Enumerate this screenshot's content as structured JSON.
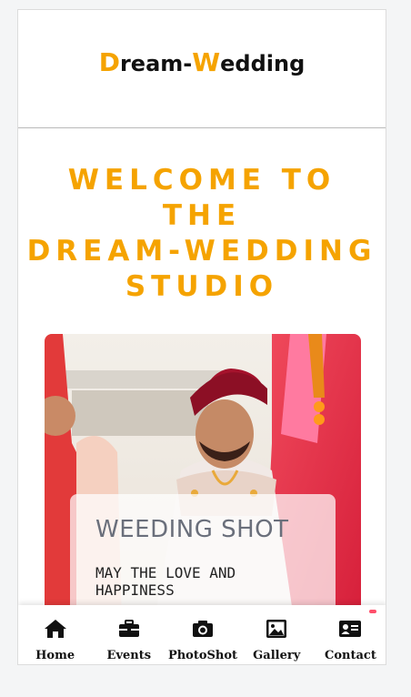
{
  "brand": {
    "first_initial": "D",
    "first_rest": "ream-",
    "second_initial": "W",
    "second_rest": "edding"
  },
  "welcome": {
    "line1": "WELCOME TO THE",
    "line2": "DREAM-WEDDING",
    "line3": "STUDIO"
  },
  "hero_card": {
    "title": "WEEDING SHOT",
    "subtitle": "MAY THE LOVE AND HAPPINESS"
  },
  "nav": {
    "items": [
      {
        "label": "Home",
        "icon": "home-icon"
      },
      {
        "label": "Events",
        "icon": "briefcase-icon"
      },
      {
        "label": "PhotoShot",
        "icon": "camera-icon"
      },
      {
        "label": "Gallery",
        "icon": "image-icon"
      },
      {
        "label": "Contact",
        "icon": "contact-card-icon"
      }
    ]
  },
  "colors": {
    "accent": "#f5a300",
    "text": "#111111",
    "card_title": "#6a6f7b",
    "notification_dot": "#ff4f6b"
  }
}
